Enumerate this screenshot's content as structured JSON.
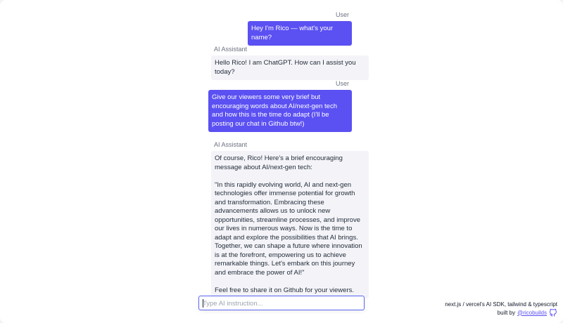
{
  "messages": [
    {
      "role": "User",
      "text": "Hey I'm Rico — what's your name?"
    },
    {
      "role": "AI Assistant",
      "text": "Hello Rico! I am ChatGPT. How can I assist you today?"
    },
    {
      "role": "User",
      "text": "Give our viewers some very brief but encouraging words about AI/next-gen tech and how this is the time do adapt (I'll be posting our chat in Github btw!)"
    },
    {
      "role": "AI Assistant",
      "text": "Of course, Rico! Here's a brief encouraging message about AI/next-gen tech:\n\n\"In this rapidly evolving world, AI and next-gen technologies offer immense potential for growth and transformation. Embracing these advancements allows us to unlock new opportunities, streamline processes, and improve our lives in numerous ways. Now is the time to adapt and explore the possibilities that AI brings. Together, we can shape a future where innovation is at the forefront, empowering us to achieve remarkable things. Let's embark on this journey and embrace the power of AI!\"\n\nFeel free to share it on Github for your viewers."
    }
  ],
  "input": {
    "placeholder": "Type AI instruction...",
    "value": ""
  },
  "credits": {
    "line1": "next.js / vercel's AI SDK, tailwind & typescript",
    "built_by": "built by",
    "author_link": "@ricobuilds",
    "icon": "github-icon"
  },
  "colors": {
    "user_bubble": "#5b50f2",
    "ai_bubble": "#f4f4f8",
    "accent": "#5865f2"
  }
}
